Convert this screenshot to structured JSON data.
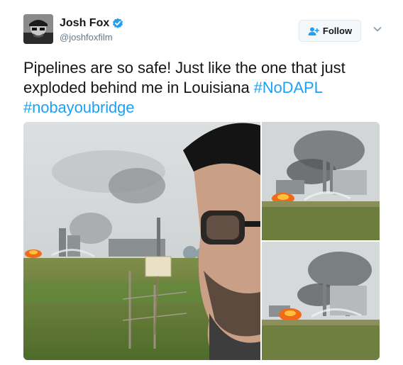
{
  "user": {
    "display_name": "Josh Fox",
    "screen_name": "@joshfoxfilm",
    "verified": true,
    "avatar_icon": "avatar-photo"
  },
  "follow_button": {
    "label": "Follow",
    "icon": "add-user-icon"
  },
  "caret_icon": "chevron-down-icon",
  "tweet": {
    "text_line_1": "Pipelines are so safe!  Just like the one that just",
    "text_line_2_plain": "exploded behind me in Louisiana ",
    "hashtag_1": "#NoDAPL",
    "hashtag_2": "#nobayoubridge"
  },
  "media": {
    "photos": [
      {
        "description_icon": "selfie-photo"
      },
      {
        "description_icon": "refinery-fire-photo"
      },
      {
        "description_icon": "refinery-fire-photo"
      }
    ]
  },
  "colors": {
    "link": "#1da1f2",
    "text": "#14171a",
    "secondary": "#657786",
    "verified": "#1da1f2"
  }
}
